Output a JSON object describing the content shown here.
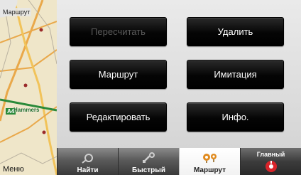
{
  "map": {
    "label": "Маршрут",
    "road_badge": "A4",
    "place_name": "Hammers"
  },
  "menu_label": "Меню",
  "buttons": {
    "recalculate": "Пересчитать",
    "delete": "Удалить",
    "route": "Маршрут",
    "simulation": "Имитация",
    "edit": "Редактировать",
    "info": "Инфо."
  },
  "tabs": {
    "find": "Найти",
    "quick": "Быстрый",
    "route": "Маршрут",
    "main": "Главный"
  },
  "colors": {
    "button_bg": "#000000",
    "button_text": "#ffffff",
    "button_disabled_text": "#5a5a5a",
    "main_tab_icon": "#d9242a"
  }
}
